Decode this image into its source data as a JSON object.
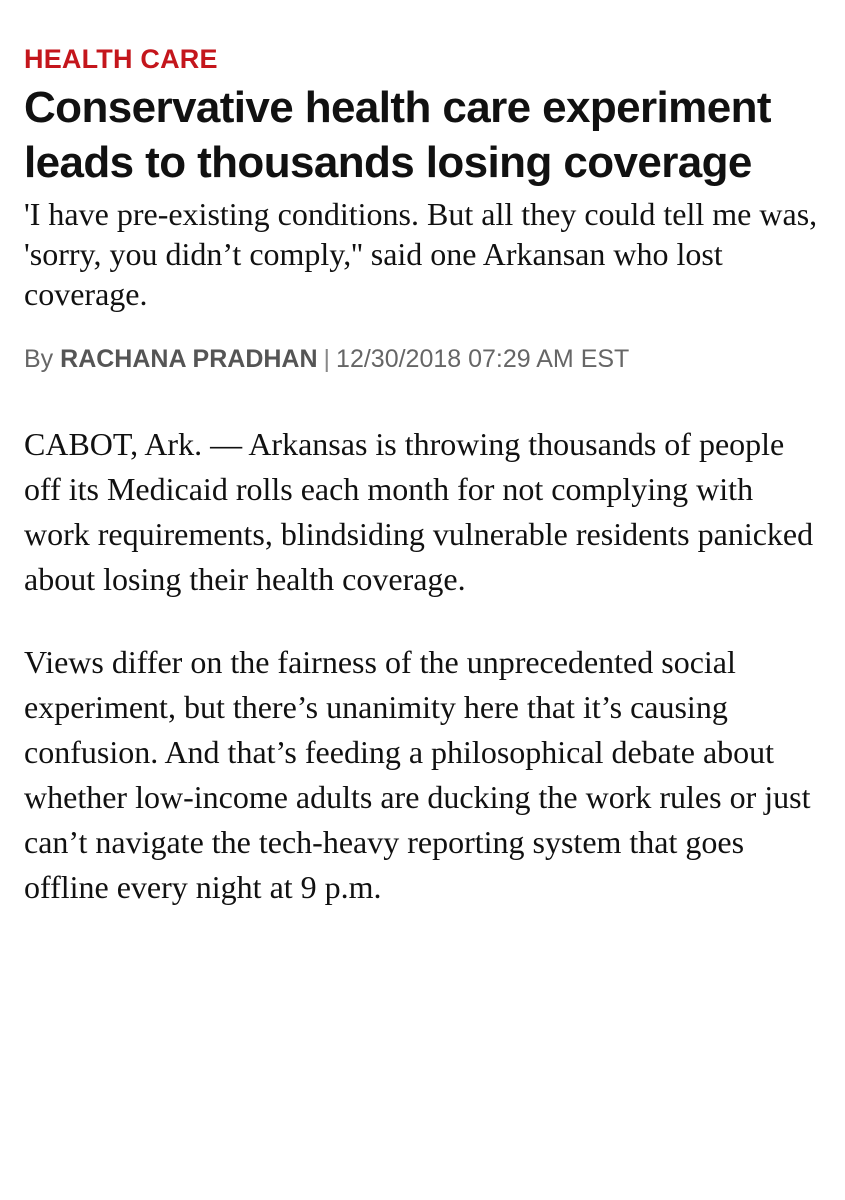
{
  "article": {
    "section": "HEALTH CARE",
    "headline": "Conservative health care experiment leads to thousands losing coverage",
    "dek": "'I have pre-existing conditions. But all they could tell me was, 'sorry, you didn’t comply,'' said one Arkansan who lost coverage.",
    "byline": {
      "prefix": "By",
      "author": "RACHANA PRADHAN",
      "separator": "|",
      "timestamp": "12/30/2018 07:29 AM EST"
    },
    "paragraphs": [
      "CABOT, Ark. — Arkansas is throwing thousands of people off its Medicaid rolls each month for not complying with work requirements, blindsiding vulnerable residents panicked about losing their health coverage.",
      "Views differ on the fairness of the unprecedented social experiment, but there’s unanimity here that it’s causing confusion. And that’s feeding a philosophical debate about whether low-income adults are ducking the work rules or just can’t navigate the tech-heavy reporting system that goes offline every night at 9 p.m."
    ]
  },
  "colors": {
    "section": "#c4161c",
    "text": "#111111",
    "byline": "#666666"
  }
}
